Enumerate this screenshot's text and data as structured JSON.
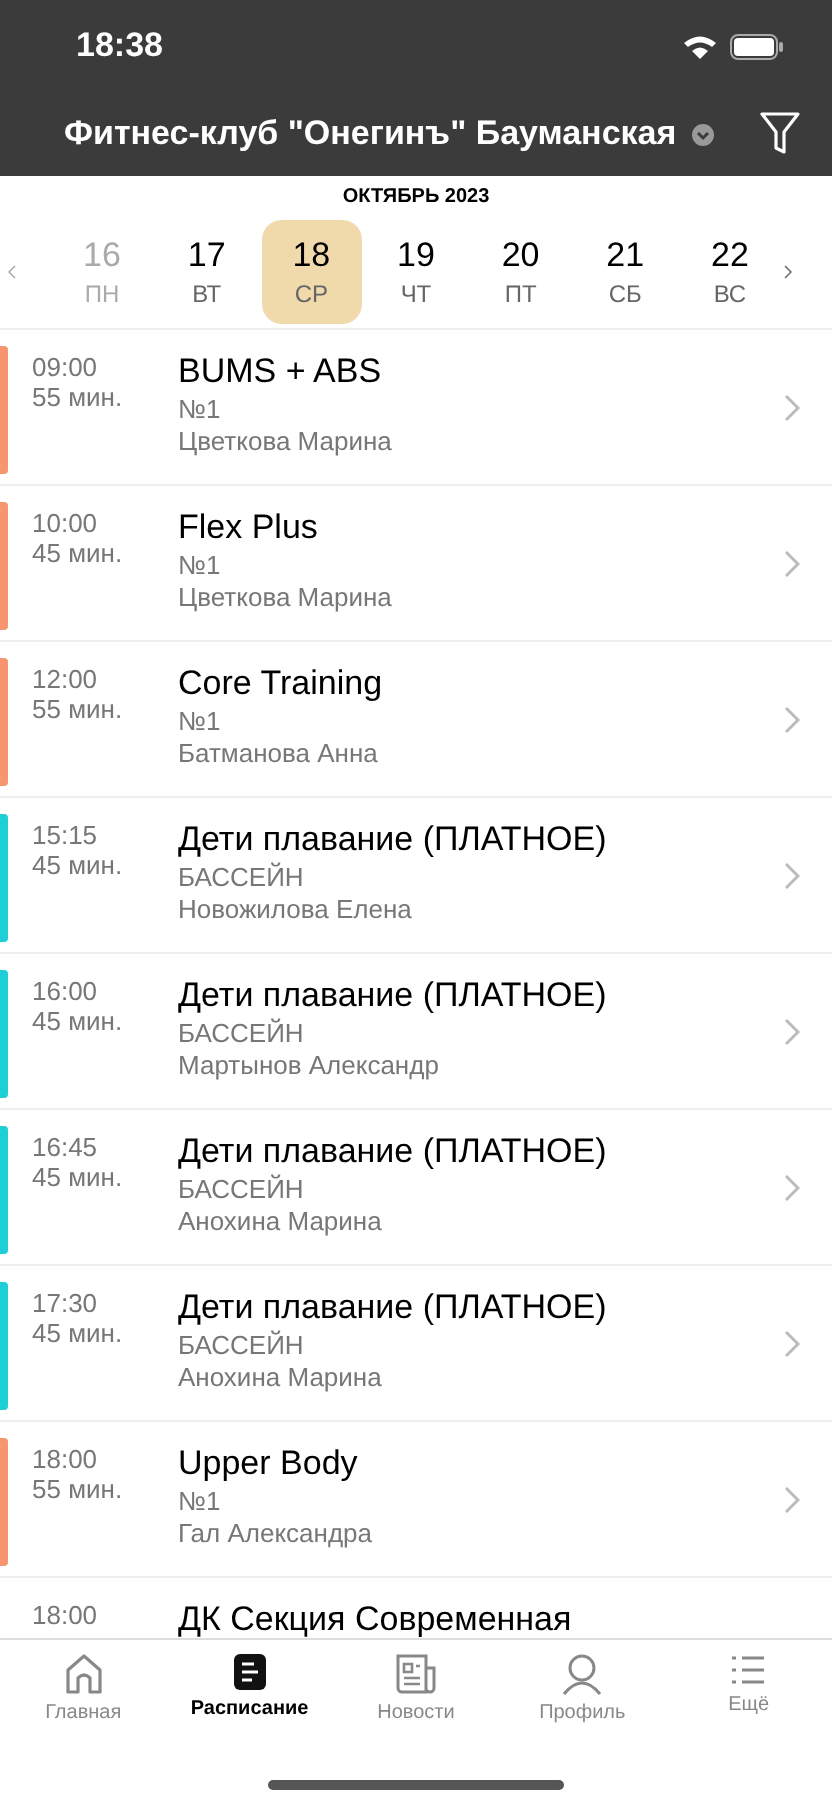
{
  "status_bar": {
    "time": "18:38"
  },
  "header": {
    "title": "Фитнес-клуб \"Онегинъ\" Бауманская"
  },
  "calendar": {
    "month": "ОКТЯБРЬ 2023",
    "days": [
      {
        "date": "16",
        "weekday": "ПН",
        "selected": false,
        "disabled": true
      },
      {
        "date": "17",
        "weekday": "ВТ",
        "selected": false,
        "disabled": false
      },
      {
        "date": "18",
        "weekday": "СР",
        "selected": true,
        "disabled": false
      },
      {
        "date": "19",
        "weekday": "ЧТ",
        "selected": false,
        "disabled": false
      },
      {
        "date": "20",
        "weekday": "ПТ",
        "selected": false,
        "disabled": false
      },
      {
        "date": "21",
        "weekday": "СБ",
        "selected": false,
        "disabled": false
      },
      {
        "date": "22",
        "weekday": "ВС",
        "selected": false,
        "disabled": false
      }
    ]
  },
  "classes": [
    {
      "time": "09:00",
      "duration": "55 мин.",
      "title": "BUMS + ABS",
      "room": "№1",
      "trainer": "Цветкова Марина",
      "color": "#f7956e"
    },
    {
      "time": "10:00",
      "duration": "45 мин.",
      "title": "Flex Plus",
      "room": "№1",
      "trainer": "Цветкова Марина",
      "color": "#f7956e"
    },
    {
      "time": "12:00",
      "duration": "55 мин.",
      "title": "Core Training",
      "room": "№1",
      "trainer": "Батманова Анна",
      "color": "#f7956e"
    },
    {
      "time": "15:15",
      "duration": "45 мин.",
      "title": "Дети плавание (ПЛАТНОЕ)",
      "room": "БАССЕЙН",
      "trainer": "Новожилова Елена",
      "color": "#1ecfd6"
    },
    {
      "time": "16:00",
      "duration": "45 мин.",
      "title": "Дети плавание (ПЛАТНОЕ)",
      "room": "БАССЕЙН",
      "trainer": "Мартынов Александр",
      "color": "#1ecfd6"
    },
    {
      "time": "16:45",
      "duration": "45 мин.",
      "title": "Дети плавание (ПЛАТНОЕ)",
      "room": "БАССЕЙН",
      "trainer": "Анохина Марина",
      "color": "#1ecfd6"
    },
    {
      "time": "17:30",
      "duration": "45 мин.",
      "title": "Дети плавание (ПЛАТНОЕ)",
      "room": "БАССЕЙН",
      "trainer": "Анохина Марина",
      "color": "#1ecfd6"
    },
    {
      "time": "18:00",
      "duration": "55 мин.",
      "title": "Upper Body",
      "room": "№1",
      "trainer": "Гал Александра",
      "color": "#f7956e"
    },
    {
      "time": "18:00",
      "title": "ДК Секция Современная"
    }
  ],
  "tab_bar": [
    {
      "kind": "home",
      "label": "Главная",
      "selected": false
    },
    {
      "kind": "schedule",
      "label": "Расписание",
      "selected": true
    },
    {
      "kind": "news",
      "label": "Новости",
      "selected": false
    },
    {
      "kind": "profile",
      "label": "Профиль",
      "selected": false
    },
    {
      "kind": "more",
      "label": "Ещё",
      "selected": false
    }
  ]
}
